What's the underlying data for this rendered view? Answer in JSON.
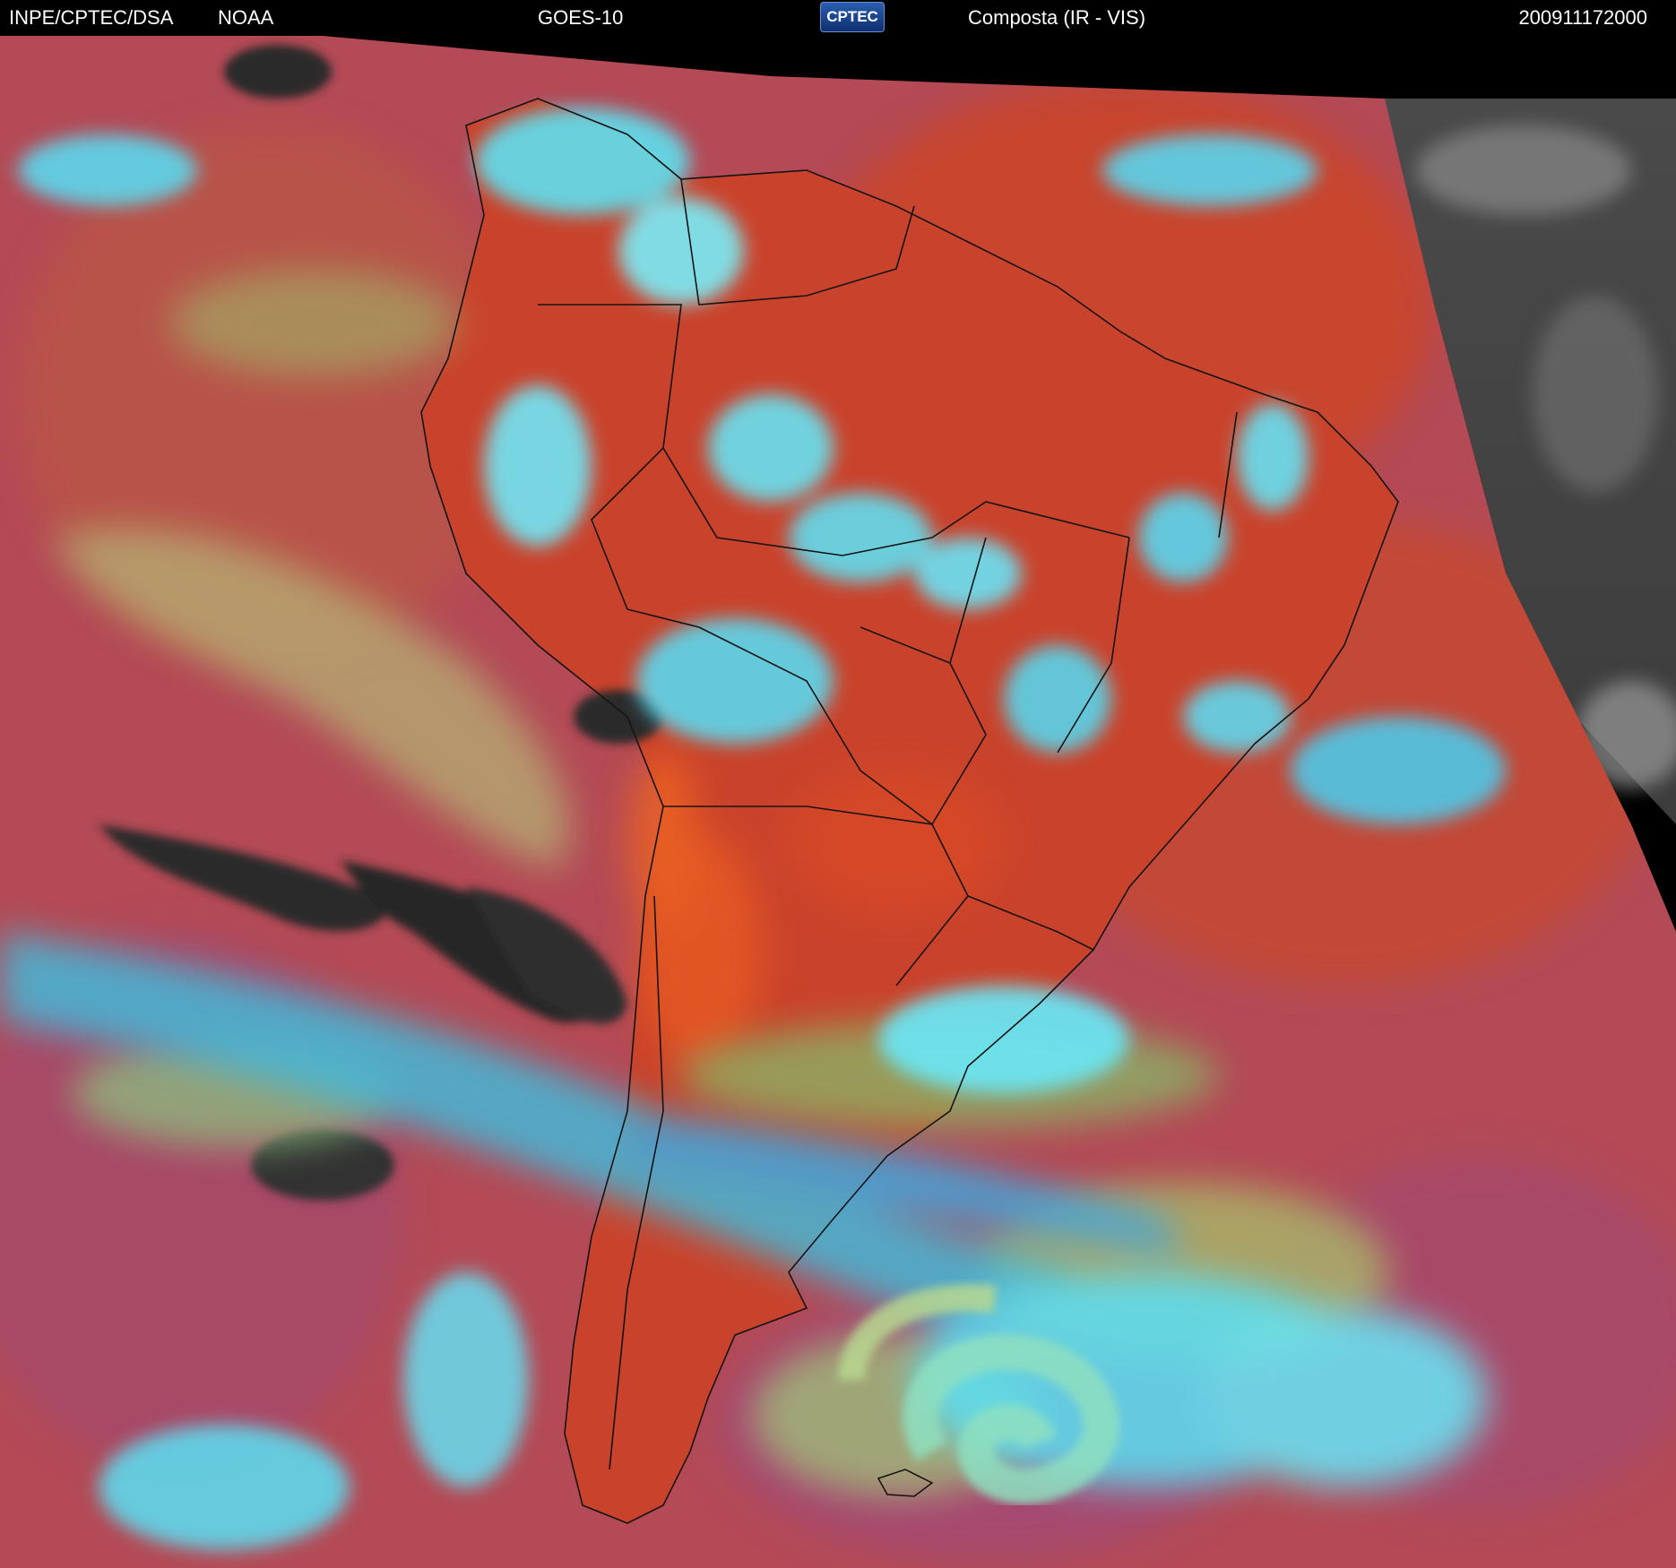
{
  "header": {
    "agency": "INPE/CPTEC/DSA",
    "partner": "NOAA",
    "satellite": "GOES-10",
    "logo_text": "CPTEC",
    "product": "Composta (IR - VIS)",
    "timestamp": "200911172000"
  },
  "colors": {
    "background": "#000000",
    "land_warm": "#c8442c",
    "ocean_warm": "#b34a55",
    "cloud_high": "#5fe8f5",
    "cloud_mid": "#8fd06a",
    "clear_dark": "#2b2b2b",
    "vis_gray": "#5a5a5a",
    "coastline": "#111111"
  }
}
